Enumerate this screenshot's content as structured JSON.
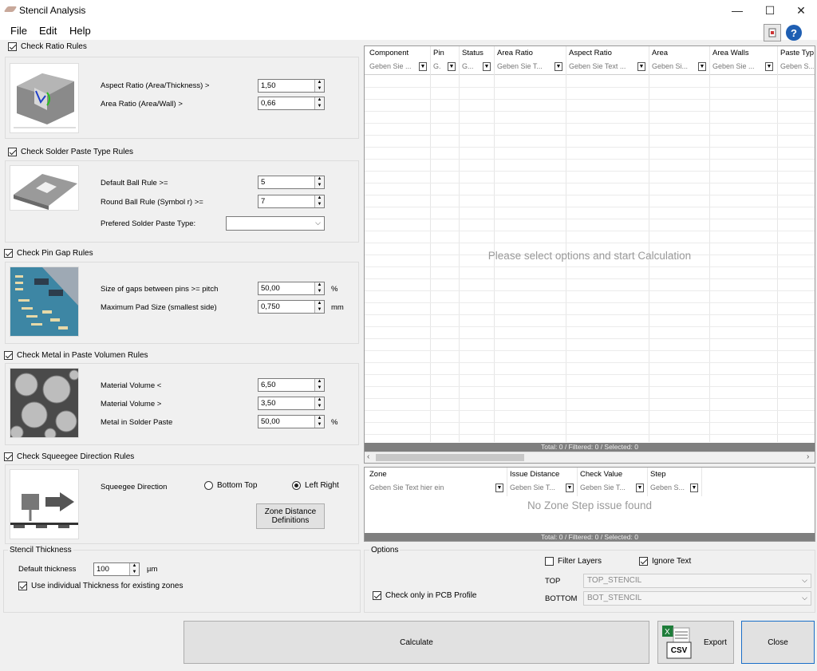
{
  "window": {
    "title": "Stencil Analysis",
    "minimize": "—",
    "maximize": "☐",
    "close": "✕"
  },
  "menu": {
    "file": "File",
    "edit": "Edit",
    "help": "Help"
  },
  "toolbar": {
    "help_glyph": "?"
  },
  "ratio": {
    "header": "Check Ratio Rules",
    "aspect_label": "Aspect Ratio (Area/Thickness) >",
    "aspect_value": "1,50",
    "area_label": "Area Ratio (Area/Wall) >",
    "area_value": "0,66"
  },
  "paste_type": {
    "header": "Check Solder Paste Type Rules",
    "default_label": "Default Ball Rule >=",
    "default_value": "5",
    "round_label": "Round Ball Rule (Symbol r) >=",
    "round_value": "7",
    "preferred_label": "Prefered Solder Paste Type:",
    "preferred_value": ""
  },
  "pin_gap": {
    "header": "Check Pin Gap Rules",
    "gap_label": "Size of gaps between pins >= pitch",
    "gap_value": "50,00",
    "gap_unit": "%",
    "pad_label": "Maximum Pad Size (smallest side)",
    "pad_value": "0,750",
    "pad_unit": "mm"
  },
  "metal": {
    "header": "Check Metal in Paste Volumen Rules",
    "vol_lt_label": "Material Volume <",
    "vol_lt_value": "6,50",
    "vol_gt_label": "Material Volume >",
    "vol_gt_value": "3,50",
    "metal_label": "Metal in Solder Paste",
    "metal_value": "50,00",
    "metal_unit": "%"
  },
  "squeegee": {
    "header": "Check Squeegee Direction Rules",
    "direction_label": "Squeegee Direction",
    "bottom_top": "Bottom Top",
    "left_right": "Left Right",
    "zone_button_1": "Zone Distance",
    "zone_button_2": "Definitions"
  },
  "thickness": {
    "header": "Stencil Thickness",
    "default_label": "Default thickness",
    "default_value": "100",
    "unit": "µm",
    "individual_label": "Use individual Thickness for existing zones"
  },
  "grid": {
    "columns": [
      {
        "label": "Component",
        "filter": "Geben Sie ..."
      },
      {
        "label": "Pin",
        "filter": "G."
      },
      {
        "label": "Status",
        "filter": "G..."
      },
      {
        "label": "Area Ratio",
        "filter": "Geben Sie T..."
      },
      {
        "label": "Aspect Ratio",
        "filter": "Geben Sie Text ..."
      },
      {
        "label": "Area",
        "filter": "Geben Si..."
      },
      {
        "label": "Area Walls",
        "filter": "Geben Sie ..."
      },
      {
        "label": "Paste Typ",
        "filter": "Geben S..."
      }
    ],
    "empty_message": "Please select options and start Calculation",
    "status": "Total: 0 / Filtered: 0 / Selected: 0"
  },
  "zone_grid": {
    "columns": [
      {
        "label": "Zone",
        "filter": "Geben Sie Text hier ein"
      },
      {
        "label": "Issue Distance",
        "filter": "Geben Sie T..."
      },
      {
        "label": "Check Value",
        "filter": "Geben Sie T..."
      },
      {
        "label": "Step",
        "filter": "Geben S..."
      }
    ],
    "empty_message": "No Zone Step issue found",
    "status": "Total: 0 / Filtered: 0 / Selected: 0"
  },
  "options": {
    "header": "Options",
    "filter_layers": "Filter Layers",
    "ignore_text": "Ignore Text",
    "top_label": "TOP",
    "top_value": "TOP_STENCIL",
    "bottom_label": "BOTTOM",
    "bottom_value": "BOT_STENCIL",
    "pcb_profile": "Check only in PCB Profile"
  },
  "actions": {
    "calculate": "Calculate",
    "csv": "CSV",
    "export": "Export",
    "close": "Close"
  }
}
